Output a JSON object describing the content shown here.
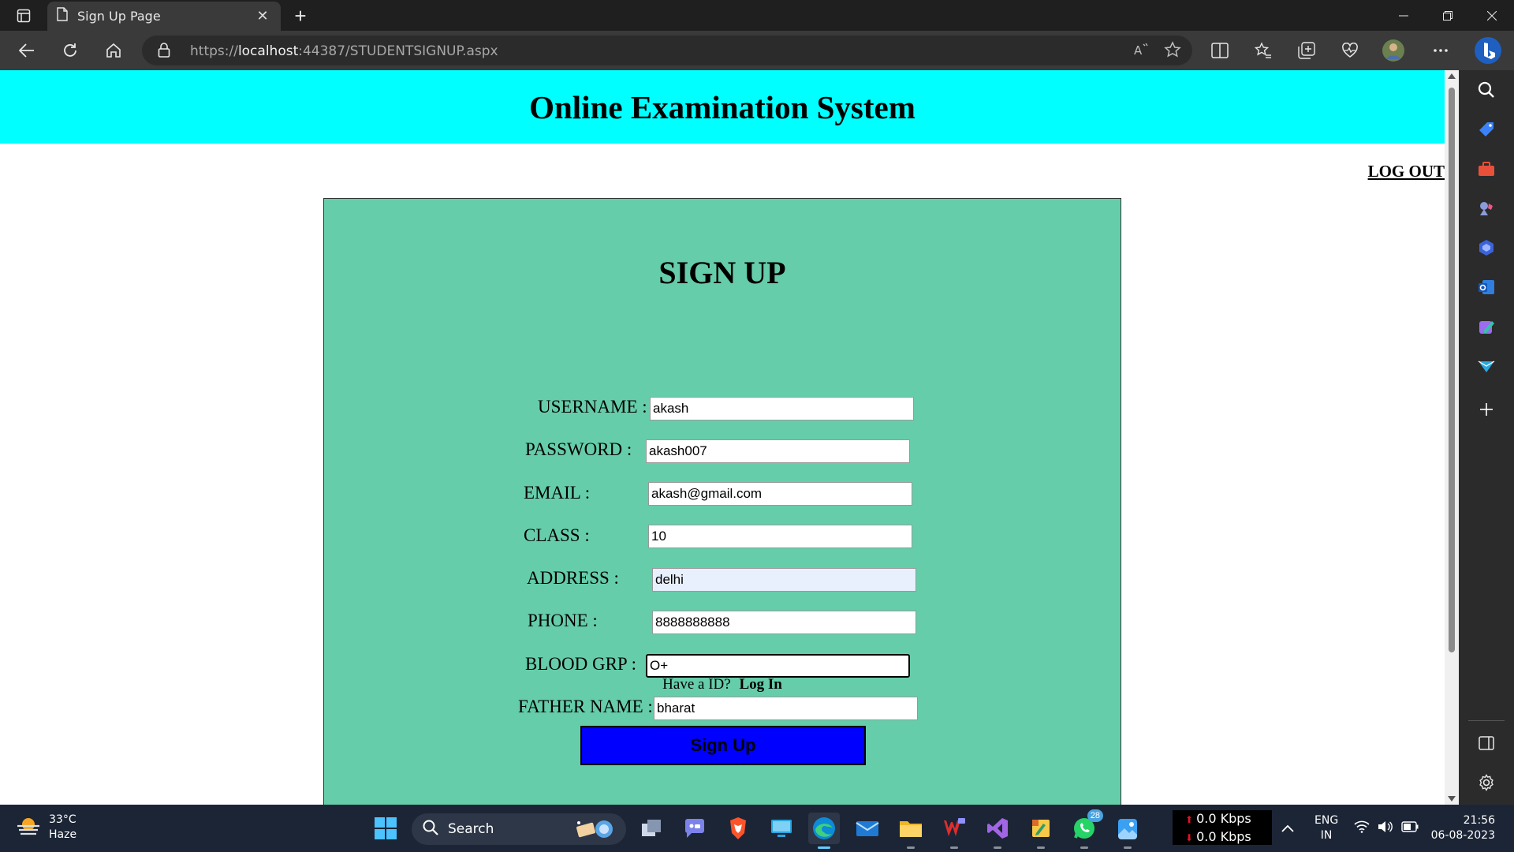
{
  "browser": {
    "tab_title": "Sign Up Page",
    "tab_close": "✕",
    "new_tab": "+",
    "url_prefix": "https://",
    "url_host": "localhost",
    "url_rest": ":44387/STUDENTSIGNUP.aspx"
  },
  "page": {
    "site_title": "Online Examination System",
    "logout_label": "LOG OUT",
    "form_title": "SIGN UP",
    "fields": {
      "username": {
        "label": "USERNAME :",
        "value": "akash"
      },
      "password": {
        "label": "PASSWORD :",
        "value": "akash007"
      },
      "email": {
        "label": "EMAIL :",
        "value": "akash@gmail.com"
      },
      "class": {
        "label": "CLASS :",
        "value": "10"
      },
      "address": {
        "label": "ADDRESS :",
        "value": "delhi"
      },
      "phone": {
        "label": "PHONE :",
        "value": "8888888888"
      },
      "blood_grp": {
        "label": "BLOOD GRP :",
        "value": "O+"
      },
      "father_name": {
        "label": "FATHER NAME :",
        "value": "bharat"
      }
    },
    "have_id_text": "Have a ID?",
    "login_link": "Log In",
    "signup_button": "Sign Up"
  },
  "taskbar": {
    "weather_temp": "33°C",
    "weather_desc": "Haze",
    "search_label": "Search",
    "whatsapp_badge": "28",
    "net_up": "0.0 Kbps",
    "net_down": "0.0 Kbps",
    "lang_top": "ENG",
    "lang_bottom": "IN",
    "time": "21:56",
    "date": "06-08-2023"
  },
  "colors": {
    "header_bg": "#00ffff",
    "panel_bg": "#66cdaa",
    "button_bg": "#0000ff"
  }
}
